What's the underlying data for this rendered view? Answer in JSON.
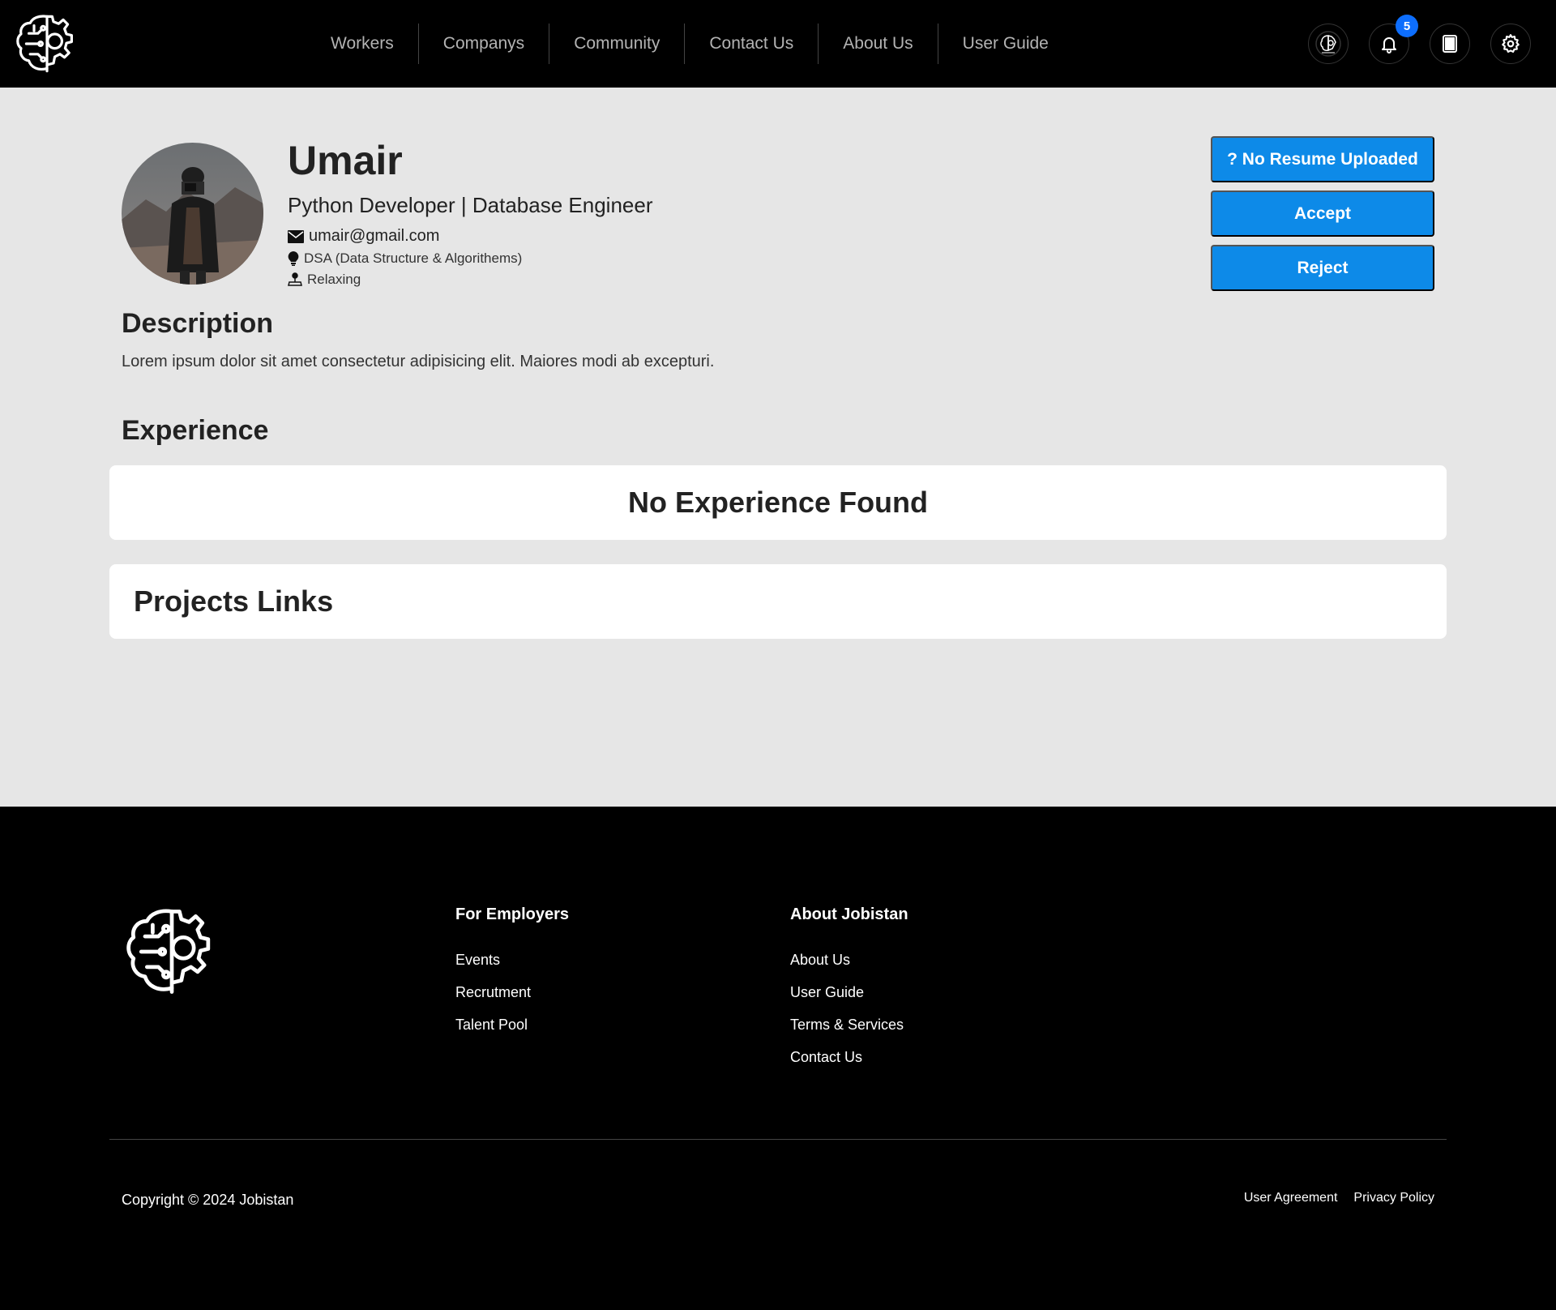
{
  "navbar": {
    "logo_icon": "brain-gear-logo",
    "links": [
      "Workers",
      "Companys",
      "Community",
      "Contact Us",
      "About Us",
      "User Guide"
    ],
    "notification_count": "5",
    "icons": [
      "profile-avatar-icon",
      "bell-icon",
      "calculator-icon",
      "gear-icon"
    ]
  },
  "profile": {
    "name": "Umair",
    "title": "Python Developer | Database Engineer",
    "email": "umair@gmail.com",
    "skill": "DSA (Data Structure & Algorithems)",
    "hobby": "Relaxing"
  },
  "actions": {
    "resume": "? No Resume Uploaded",
    "accept": "Accept",
    "reject": "Reject"
  },
  "description": {
    "heading": "Description",
    "text": "Lorem ipsum dolor sit amet consectetur adipisicing elit. Maiores modi ab excepturi."
  },
  "experience": {
    "heading": "Experience",
    "empty_message": "No Experience Found"
  },
  "projects": {
    "heading": "Projects Links"
  },
  "footer": {
    "col1": {
      "heading": "For Employers",
      "links": [
        "Events",
        "Recrutment",
        "Talent Pool"
      ]
    },
    "col2": {
      "heading": "About Jobistan",
      "links": [
        "About Us",
        "User Guide",
        "Terms & Services",
        "Contact Us"
      ]
    },
    "copyright": "Copyright © 2024 Jobistan",
    "bottom_links": [
      "User Agreement",
      "Privacy Policy"
    ]
  },
  "colors": {
    "accent": "#0d8ae8",
    "badge": "#0d6efd",
    "navbar_bg": "#000000",
    "page_bg": "#e6e6e6"
  }
}
